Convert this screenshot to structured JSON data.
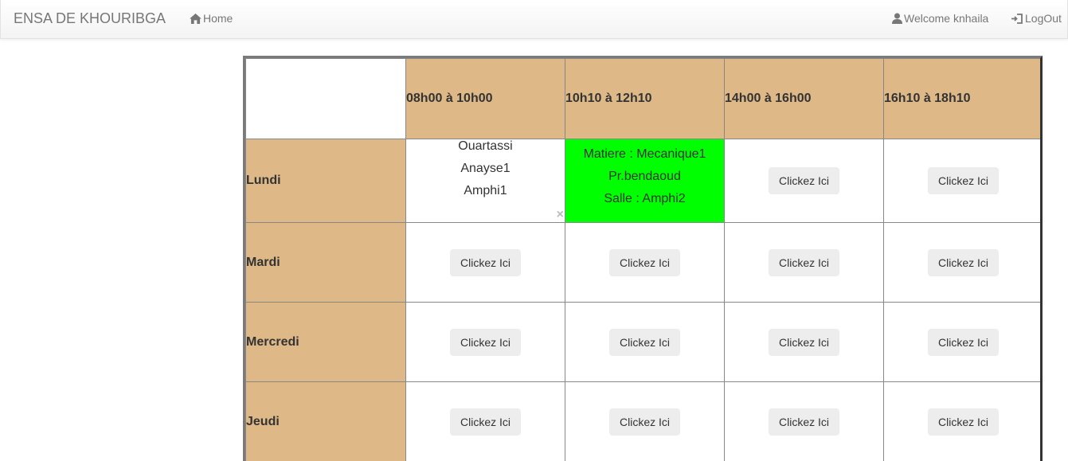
{
  "navbar": {
    "brand": "ENSA DE KHOURIBGA",
    "home_label": "Home",
    "welcome_label": "Welcome knhaila",
    "logout_label": "LogOut"
  },
  "timetable": {
    "time_slots": [
      "08h00 à 10h00",
      "10h10 à 12h10",
      "14h00 à 16h00",
      "16h10 à 18h10"
    ],
    "days": [
      "Lundi",
      "Mardi",
      "Mercredi",
      "Jeudi"
    ],
    "button_label": "Clickez Ici",
    "close_symbol": "×",
    "lundi_slot1": {
      "lines": [
        "Ouartassi",
        "Anayse1",
        "Amphi1"
      ]
    },
    "lundi_slot2": {
      "lines": [
        "Matiere : Mecanique1",
        "Pr.bendaoud",
        "Salle : Amphi2"
      ],
      "highlight_color": "#00ff00"
    }
  },
  "colors": {
    "header_bg": "#deb887",
    "highlight": "#00ff00",
    "button_bg": "#ededed"
  }
}
